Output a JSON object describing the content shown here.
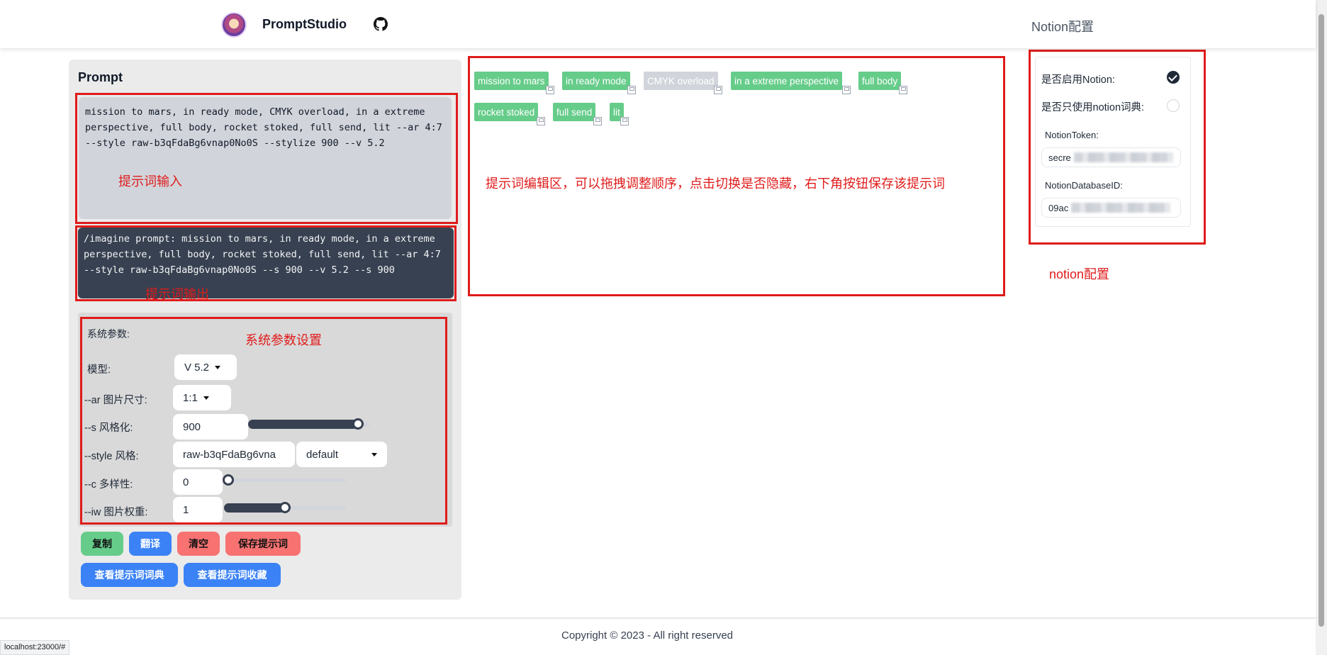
{
  "header": {
    "brand": "PromptStudio",
    "notion_link": "Notion配置"
  },
  "prompt": {
    "title": "Prompt",
    "input_value": "mission to mars, in ready mode, CMYK overload, in a extreme perspective, full body, rocket stoked, full send, lit --ar 4:7 --style raw-b3qFdaBg6vnap0No0S --stylize 900 --v 5.2",
    "output_value": "/imagine prompt: mission to mars, in ready mode, in a extreme perspective, full body, rocket stoked, full send, lit --ar 4:7 --style raw-b3qFdaBg6vnap0No0S --s 900 --v 5.2 --s 900"
  },
  "params": {
    "heading": "系统参数:",
    "model_label": "模型:",
    "model_value": "V 5.2",
    "ar_label": "--ar 图片尺寸:",
    "ar_value": "1:1",
    "s_label": "--s 风格化:",
    "s_value": "900",
    "s_slider_fraction": 0.9,
    "style_label": "--style 风格:",
    "style_value": "raw-b3qFdaBg6vna",
    "style_select": "default",
    "c_label": "--c 多样性:",
    "c_value": "0",
    "c_slider_fraction": 0.0,
    "iw_label": "--iw 图片权重:",
    "iw_value": "1",
    "iw_slider_fraction": 0.5
  },
  "buttons": {
    "copy": "复制",
    "translate": "翻译",
    "clear": "清空",
    "save_prompt": "保存提示词",
    "view_dictionary": "查看提示词词典",
    "view_favorites": "查看提示词收藏"
  },
  "tags": [
    {
      "label": "mission to mars",
      "hidden": false
    },
    {
      "label": "in ready mode",
      "hidden": false
    },
    {
      "label": "CMYK overload",
      "hidden": true
    },
    {
      "label": "in a extreme perspective",
      "hidden": false
    },
    {
      "label": "full body",
      "hidden": false
    },
    {
      "label": "rocket stoked",
      "hidden": false
    },
    {
      "label": "full send",
      "hidden": false
    },
    {
      "label": "lit",
      "hidden": false
    }
  ],
  "notion": {
    "enable_label": "是否启用Notion:",
    "enable_checked": true,
    "dict_only_label": "是否只使用notion词典:",
    "dict_only_checked": false,
    "token_label": "NotionToken:",
    "token_value": "secre",
    "db_label": "NotionDatabaseID:",
    "db_value": "09ac"
  },
  "annotations": {
    "prompt_input": "提示词输入",
    "prompt_output": "提示词输出",
    "params": "系统参数设置",
    "editor": "提示词编辑区，可以拖拽调整顺序，点击切换是否隐藏，右下角按钮保存该提示词",
    "notion": "notion配置"
  },
  "footer": {
    "copyright": "Copyright © 2023 - All right reserved"
  },
  "status_url": "localhost:23000/#",
  "colors": {
    "tag_active": "#66cc8a",
    "tag_hidden": "#d1d5db",
    "annotation_red": "#e01b1b",
    "primary_blue": "#3b82f6"
  }
}
